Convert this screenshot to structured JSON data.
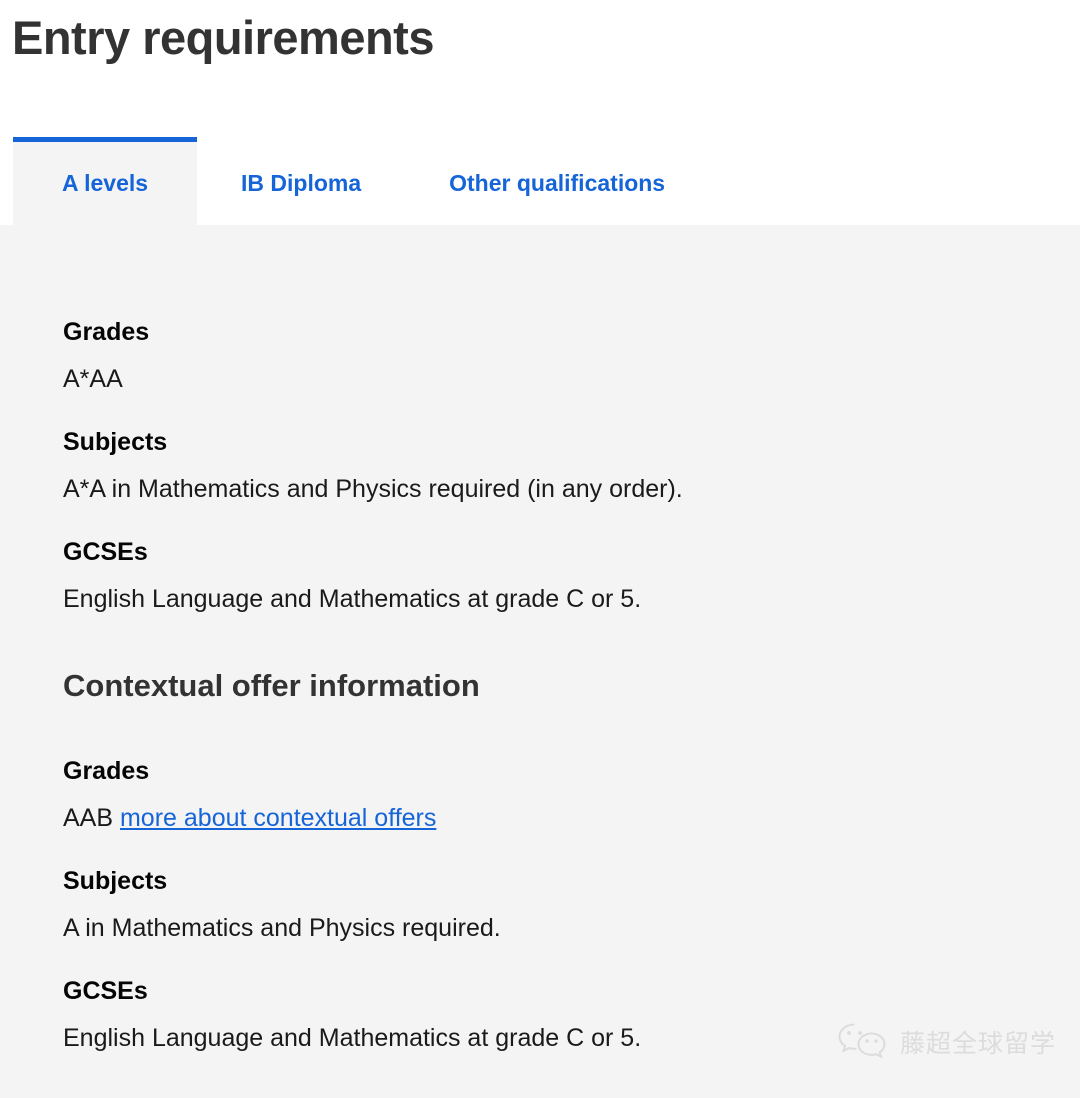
{
  "page": {
    "title": "Entry requirements"
  },
  "tabs": [
    {
      "label": "A levels",
      "active": true
    },
    {
      "label": "IB Diploma",
      "active": false
    },
    {
      "label": "Other qualifications",
      "active": false
    }
  ],
  "standard_offer": {
    "grades_label": "Grades",
    "grades_value": "A*AA",
    "subjects_label": "Subjects",
    "subjects_value": "A*A in Mathematics and Physics required (in any order).",
    "gcses_label": "GCSEs",
    "gcses_value": "English Language and Mathematics at grade C or 5."
  },
  "contextual_offer": {
    "heading": "Contextual offer information",
    "grades_label": "Grades",
    "grades_value": "AAB",
    "grades_link": "more about contextual offers",
    "subjects_label": "Subjects",
    "subjects_value": "A in Mathematics and Physics required.",
    "gcses_label": "GCSEs",
    "gcses_value": "English Language and Mathematics at grade C or 5."
  },
  "watermark": {
    "text": "藤超全球留学",
    "icon": "wechat-icon"
  },
  "colors": {
    "accent": "#1565d8",
    "panel_bg": "#f4f4f4",
    "heading": "#333333",
    "body": "#1a1a1a",
    "watermark": "#dcdcdc"
  }
}
